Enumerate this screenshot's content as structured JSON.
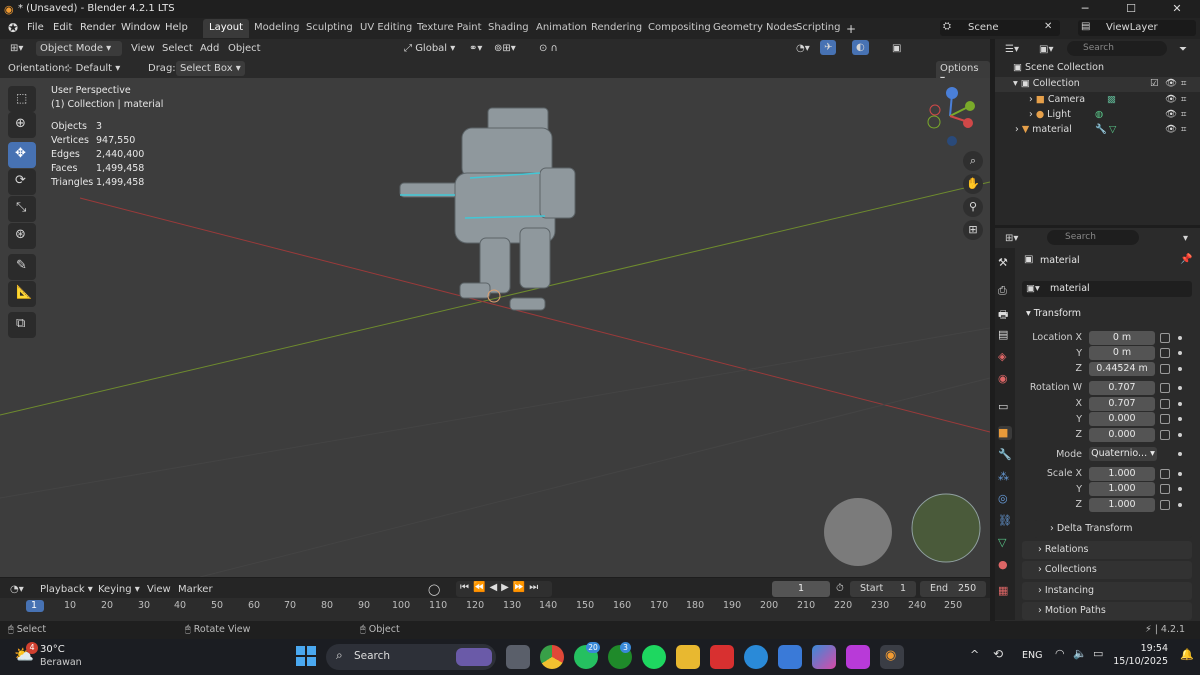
{
  "window": {
    "title": "* (Unsaved) - Blender 4.2.1 LTS"
  },
  "menu": [
    "File",
    "Edit",
    "Render",
    "Window",
    "Help"
  ],
  "workspaces": [
    "Layout",
    "Modeling",
    "Sculpting",
    "UV Editing",
    "Texture Paint",
    "Shading",
    "Animation",
    "Rendering",
    "Compositing",
    "Geometry Nodes",
    "Scripting"
  ],
  "scene": {
    "name": "Scene",
    "view_layer": "ViewLayer"
  },
  "viewport_header": {
    "mode": "Object Mode",
    "menus": [
      "View",
      "Select",
      "Add",
      "Object"
    ],
    "transform_orientation": "Global",
    "orientation_label": "Orientation:",
    "orientation_value": "Default",
    "drag_label": "Drag:",
    "drag_value": "Select Box",
    "options": "Options"
  },
  "viewport_info": {
    "perspective": "User Perspective",
    "collection": "(1) Collection | material",
    "stats": [
      {
        "label": "Objects",
        "value": "3"
      },
      {
        "label": "Vertices",
        "value": "947,550"
      },
      {
        "label": "Edges",
        "value": "2,440,400"
      },
      {
        "label": "Faces",
        "value": "1,499,458"
      },
      {
        "label": "Triangles",
        "value": "1,499,458"
      }
    ]
  },
  "outliner": {
    "search_placeholder": "Search",
    "root": "Scene Collection",
    "items": [
      "Collection",
      "Camera",
      "Light",
      "material"
    ]
  },
  "properties": {
    "search_placeholder": "Search",
    "object_name": "material",
    "datablock": "material",
    "transform_header": "Transform",
    "location": {
      "label": "Location X",
      "x": "0 m",
      "y": "0 m",
      "z": "0.44524 m"
    },
    "rotation": {
      "label": "Rotation W",
      "w": "0.707",
      "x": "0.707",
      "y": "0.000",
      "z": "0.000"
    },
    "mode_label": "Mode",
    "mode_value": "Quaternio...",
    "scale": {
      "label": "Scale X",
      "x": "1.000",
      "y": "1.000",
      "z": "1.000"
    },
    "axis_labels": {
      "x": "X",
      "y": "Y",
      "z": "Z"
    },
    "delta": "Delta Transform",
    "panels": [
      "Relations",
      "Collections",
      "Instancing",
      "Motion Paths"
    ]
  },
  "timeline": {
    "menus": [
      "Playback",
      "Keying",
      "View",
      "Marker"
    ],
    "current_frame": "1",
    "start_label": "Start",
    "start": "1",
    "end_label": "End",
    "end": "250",
    "ticks": [
      "1",
      "10",
      "20",
      "30",
      "40",
      "50",
      "60",
      "70",
      "80",
      "90",
      "100",
      "110",
      "120",
      "130",
      "140",
      "150",
      "160",
      "170",
      "180",
      "190",
      "200",
      "210",
      "220",
      "230",
      "240",
      "250"
    ]
  },
  "status_bar": {
    "select": "Select",
    "rotate": "Rotate View",
    "object": "Object",
    "version": "4.2.1"
  },
  "taskbar": {
    "weather_temp": "30°C",
    "weather_desc": "Berawan",
    "weather_badge": "4",
    "search": "Search",
    "whatsapp_badge": "20",
    "xbox_badge": "3",
    "lang": "ENG",
    "time": "19:54",
    "date": "15/10/2025"
  },
  "colors": {
    "accent": "#4772b3",
    "viewport": "#3d3d3d",
    "x_axis": "#9b3a3a",
    "y_axis": "#6e8b2e"
  }
}
